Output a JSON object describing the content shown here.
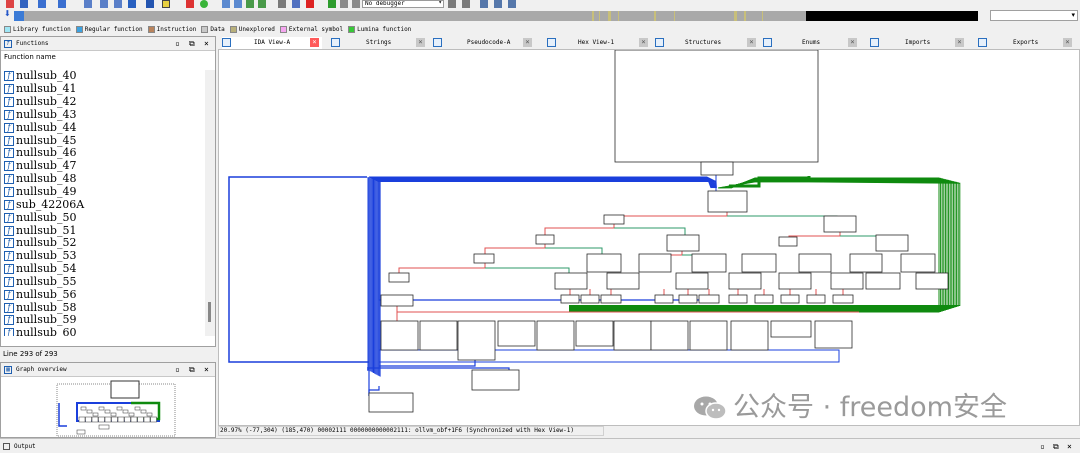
{
  "toolbar": {
    "debugger_select": "No debugger",
    "icons": [
      "save-icon",
      "back-icon",
      "forward-icon",
      "jump-icon",
      "step-icon",
      "download-icon",
      "text-icon",
      "stop-icon",
      "green-circle-icon",
      "stack-icon",
      "graph-icon",
      "chart-icon",
      "pin-icon",
      "cross-icon",
      "play-icon",
      "pause-icon",
      "stop-square-icon",
      "attach-icon",
      "detach-icon",
      "list-icon",
      "window-icon"
    ]
  },
  "legend": [
    {
      "label": "Library function",
      "color": "#9ee6f5"
    },
    {
      "label": "Regular function",
      "color": "#3da2e0"
    },
    {
      "label": "Instruction",
      "color": "#b9835c"
    },
    {
      "label": "Data",
      "color": "#c8c8c8"
    },
    {
      "label": "Unexplored",
      "color": "#b8b07b"
    },
    {
      "label": "External symbol",
      "color": "#f5a6f0"
    },
    {
      "label": "Lumina function",
      "color": "#37c837"
    }
  ],
  "functions_panel": {
    "title": "Functions",
    "column_header": "Function name",
    "items": [
      "nullsub_40",
      "nullsub_41",
      "nullsub_42",
      "nullsub_43",
      "nullsub_44",
      "nullsub_45",
      "nullsub_46",
      "nullsub_47",
      "nullsub_48",
      "nullsub_49",
      "sub_42206A",
      "nullsub_50",
      "nullsub_51",
      "nullsub_52",
      "nullsub_53",
      "nullsub_54",
      "nullsub_55",
      "nullsub_56",
      "nullsub_58",
      "nullsub_59",
      "nullsub_60"
    ],
    "line_status": "Line 293 of 293"
  },
  "overview_panel": {
    "title": "Graph overview"
  },
  "tabs": [
    {
      "label": "IDA View-A",
      "active": true
    },
    {
      "label": "Strings",
      "active": false
    },
    {
      "label": "Pseudocode-A",
      "active": false
    },
    {
      "label": "Hex View-1",
      "active": false
    },
    {
      "label": "Structures",
      "active": false
    },
    {
      "label": "Enums",
      "active": false
    },
    {
      "label": "Imports",
      "active": false
    },
    {
      "label": "Exports",
      "active": false
    }
  ],
  "graph_status": "20.97% (-77,304) (185,470) 00002111 0000000000002111: ollvm_obf+1F6 (Synchronized with Hex View-1)",
  "watermark": "公众号 · freedom安全",
  "output_bar": {
    "title": "Output"
  },
  "colors": {
    "edge_blue": "#1a3fdc",
    "edge_green": "#0f8a0f",
    "edge_red": "#e05050",
    "edge_teal": "#2e9a6a"
  }
}
